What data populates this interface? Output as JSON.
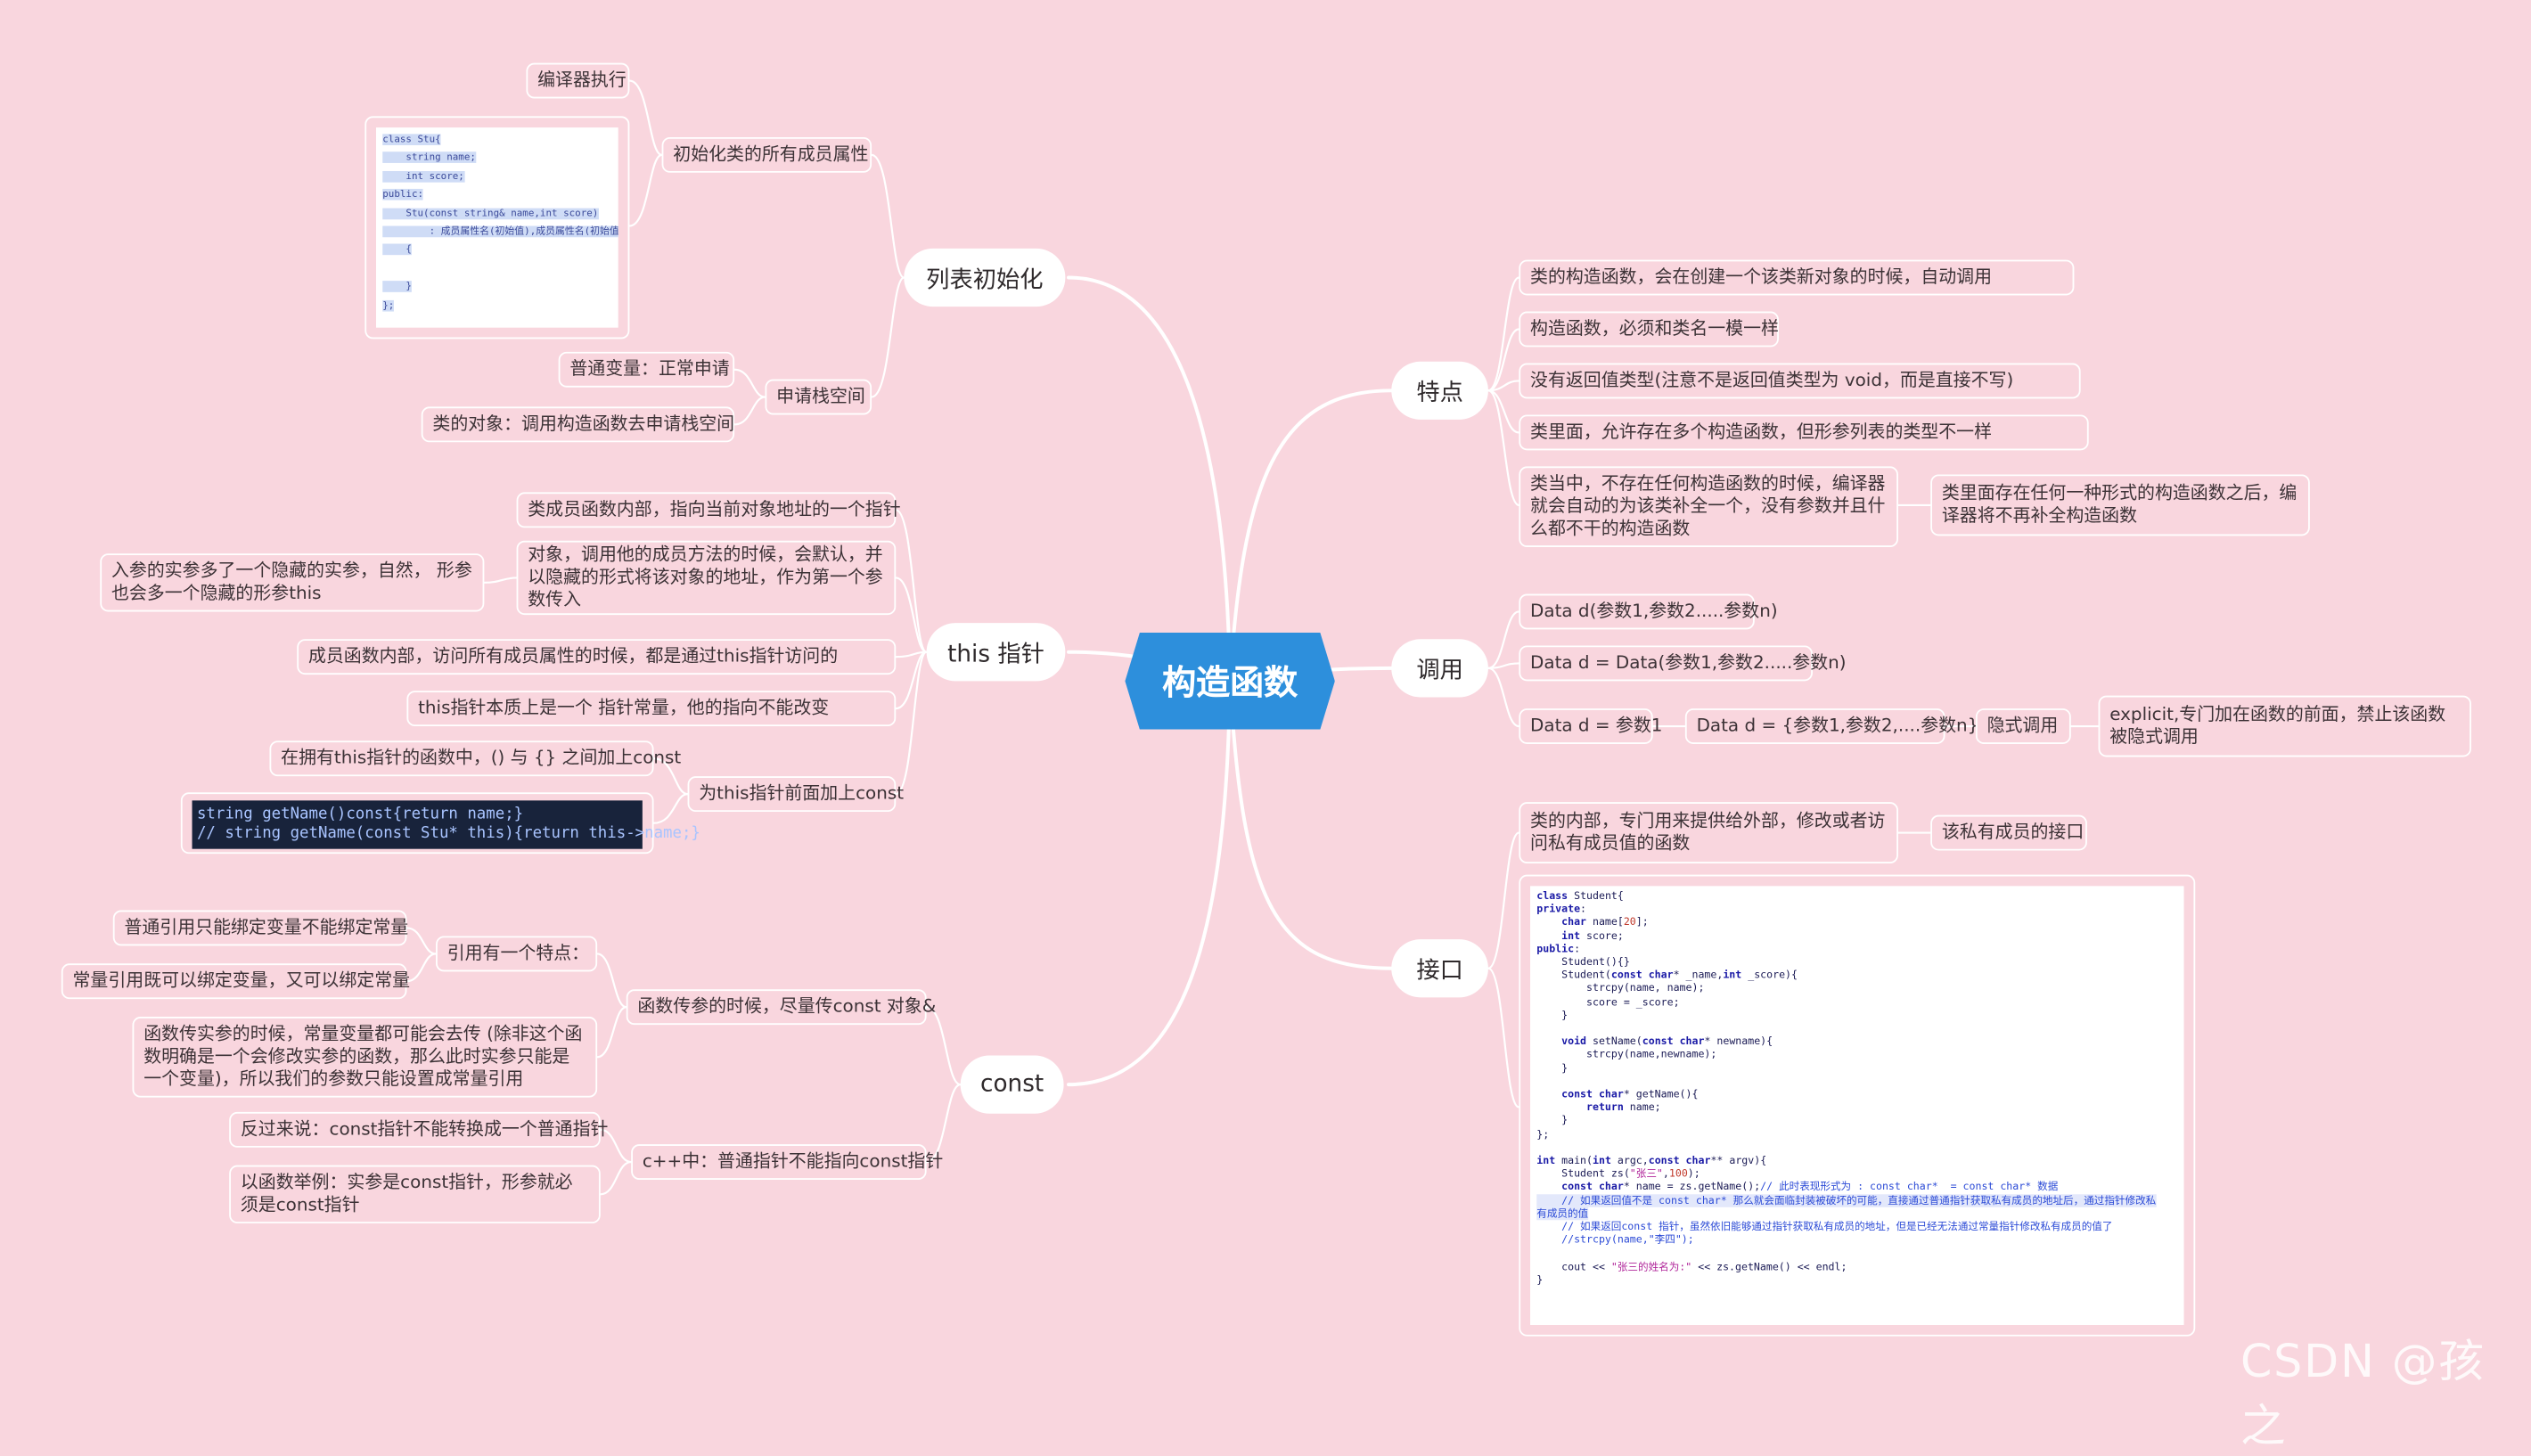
{
  "root": "构造函数",
  "branches": {
    "init_list": "列表初始化",
    "this_ptr": "this 指针",
    "const": "const",
    "features": "特点",
    "call": "调用",
    "interface": "接口"
  },
  "init_list": {
    "all_members": "初始化类的所有成员属性",
    "compiler": "编译器执行",
    "stack": "申请栈空间",
    "normal_var": "普通变量：正常申请",
    "class_obj": "类的对象：调用构造函数去申请栈空间",
    "code": [
      "class Stu{",
      "    string name;",
      "    int score;",
      "public:",
      "    Stu(const string& name,int score)",
      "        : 成员属性名(初始值),成员属性名(初始值",
      "    {",
      "",
      "    }",
      "};"
    ]
  },
  "this_ptr": {
    "points_current": "类成员函数内部，指向当前对象地址的一个指针",
    "hidden_param": "对象，调用他的成员方法的时候，会默认，并以隐藏的形式将该对象的地址，作为第一个参数传入",
    "hidden_arg": "入参的实参多了一个隐藏的实参，自然， 形参也会多一个隐藏的形参this",
    "access_members": "成员函数内部，访问所有成员属性的时候，都是通过this指针访问的",
    "ptr_const": "this指针本质上是一个 指针常量，他的指向不能改变",
    "add_const": "为this指针前面加上const",
    "const_pos": "在拥有this指针的函数中，() 与 {} 之间加上const",
    "code": [
      "string getName()const{return name;}",
      "// string getName(const Stu* this){return this->name;}"
    ]
  },
  "const_branch": {
    "param_pass": "函数传参的时候，尽量传const 对象&",
    "ref_feature": "引用有一个特点：",
    "normal_ref": "普通引用只能绑定变量不能绑定常量",
    "const_ref": "常量引用既可以绑定变量，又可以绑定常量",
    "param_detail": "函数传实参的时候，常量变量都可能会去传 (除非这个函数明确是一个会修改实参的函数，那么此时实参只能是一个变量)，所以我们的参数只能设置成常量引用",
    "cpp_ptr": "c++中：普通指针不能指向const指针",
    "reverse": "反过来说：const指针不能转换成一个普通指针",
    "example": "以函数举例：实参是const指针，形参就必须是const指针"
  },
  "features": {
    "items": [
      "类的构造函数，会在创建一个该类新对象的时候，自动调用",
      "构造函数，必须和类名一模一样",
      "没有返回值类型(注意不是返回值类型为 void，而是直接不写)",
      "类里面，允许存在多个构造函数，但形参列表的类型不一样",
      "类当中，不存在任何构造函数的时候，编译器就会自动的为该类补全一个，没有参数并且什么都不干的构造函数"
    ],
    "no_auto": "类里面存在任何一种形式的构造函数之后，编译器将不再补全构造函数"
  },
  "call": {
    "items": [
      "Data d(参数1,参数2.....参数n)",
      "Data d = Data(参数1,参数2.....参数n)",
      "Data d = 参数1"
    ],
    "brace": "Data d = {参数1,参数2,....参数n}",
    "implicit": "隐式调用",
    "explicit": " explicit,专门加在函数的前面，禁止该函数被隐式调用"
  },
  "interface": {
    "desc": "类的内部，专门用来提供给外部，修改或者访问私有成员值的函数",
    "private_if": "该私有成员的接口"
  },
  "watermark": "CSDN @孩之"
}
